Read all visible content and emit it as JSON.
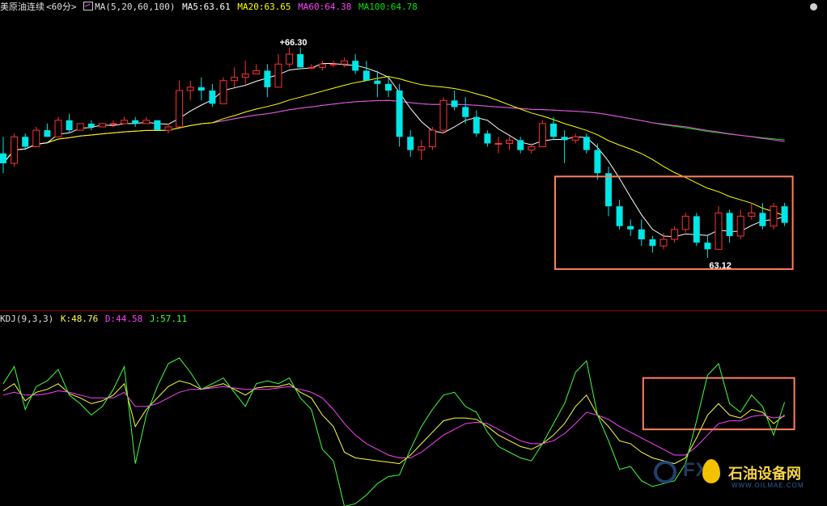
{
  "header": {
    "symbol": "美原油连续",
    "period": "<60分>",
    "ma_params": "MA(5,20,60,100)",
    "ma5": "MA5:63.61",
    "ma20": "MA20:63.65",
    "ma60": "MA60:64.38",
    "ma100": "MA100:64.78"
  },
  "kdj_header": {
    "params": "KDJ(9,3,3)",
    "k": "K:48.76",
    "d": "D:44.58",
    "j": "J:57.11"
  },
  "colors": {
    "up": "#ff3232",
    "down": "#00e5e5",
    "ma5": "#ffffff",
    "ma20": "#ffff00",
    "ma60": "#ff40ff",
    "ma100": "#00e600",
    "k": "#ffff40",
    "d": "#ff40ff",
    "j": "#40ff40",
    "highlight_box": "#ff8060"
  },
  "chart_data": [
    {
      "type": "candlestick",
      "ylim": [
        62.35,
        66.75
      ],
      "max_label": "66.30",
      "min_label": "63.12",
      "candles": [
        [
          64.7,
          64.95,
          64.4,
          64.55
        ],
        [
          64.55,
          65.0,
          64.5,
          64.95
        ],
        [
          64.95,
          65.0,
          64.75,
          64.8
        ],
        [
          64.8,
          65.1,
          64.8,
          65.05
        ],
        [
          65.05,
          65.15,
          64.95,
          64.95
        ],
        [
          64.95,
          65.25,
          64.95,
          65.2
        ],
        [
          65.2,
          65.3,
          65.0,
          65.05
        ],
        [
          65.05,
          65.15,
          65.05,
          65.15
        ],
        [
          65.15,
          65.2,
          65.05,
          65.1
        ],
        [
          65.1,
          65.15,
          65.1,
          65.15
        ],
        [
          65.15,
          65.2,
          65.1,
          65.15
        ],
        [
          65.15,
          65.25,
          65.15,
          65.2
        ],
        [
          65.2,
          65.25,
          65.1,
          65.15
        ],
        [
          65.15,
          65.25,
          65.15,
          65.2
        ],
        [
          65.2,
          65.2,
          65.05,
          65.05
        ],
        [
          65.05,
          65.15,
          65.0,
          65.1
        ],
        [
          65.1,
          65.8,
          65.1,
          65.65
        ],
        [
          65.65,
          65.8,
          65.5,
          65.7
        ],
        [
          65.7,
          65.85,
          65.5,
          65.65
        ],
        [
          65.65,
          65.75,
          65.4,
          65.45
        ],
        [
          65.45,
          65.85,
          65.45,
          65.8
        ],
        [
          65.8,
          66.0,
          65.7,
          65.85
        ],
        [
          65.85,
          66.1,
          65.75,
          65.9
        ],
        [
          65.9,
          66.05,
          65.9,
          65.95
        ],
        [
          65.95,
          66.05,
          65.55,
          65.7
        ],
        [
          65.7,
          66.2,
          65.7,
          66.05
        ],
        [
          66.05,
          66.3,
          66.0,
          66.2
        ],
        [
          66.2,
          66.3,
          66.0,
          66.0
        ],
        [
          66.0,
          66.05,
          66.0,
          66.0
        ],
        [
          66.0,
          66.1,
          65.95,
          66.05
        ],
        [
          66.05,
          66.1,
          66.0,
          66.05
        ],
        [
          66.05,
          66.15,
          66.0,
          66.1
        ],
        [
          66.1,
          66.2,
          65.9,
          65.95
        ],
        [
          65.95,
          66.1,
          65.8,
          65.8
        ],
        [
          65.8,
          65.95,
          65.55,
          65.75
        ],
        [
          65.75,
          65.85,
          65.55,
          65.65
        ],
        [
          65.65,
          65.75,
          64.8,
          64.95
        ],
        [
          64.95,
          65.05,
          64.65,
          64.75
        ],
        [
          64.75,
          64.9,
          64.6,
          64.8
        ],
        [
          64.8,
          65.1,
          64.75,
          65.05
        ],
        [
          65.05,
          65.55,
          65.0,
          65.5
        ],
        [
          65.5,
          65.65,
          65.35,
          65.4
        ],
        [
          65.4,
          65.55,
          65.15,
          65.25
        ],
        [
          65.25,
          65.35,
          64.95,
          65.0
        ],
        [
          65.0,
          65.05,
          64.8,
          64.85
        ],
        [
          64.85,
          64.95,
          64.7,
          64.85
        ],
        [
          64.85,
          64.95,
          64.75,
          64.9
        ],
        [
          64.9,
          64.95,
          64.7,
          64.75
        ],
        [
          64.75,
          64.85,
          64.7,
          64.8
        ],
        [
          64.8,
          65.2,
          64.8,
          65.15
        ],
        [
          65.15,
          65.25,
          64.9,
          64.95
        ],
        [
          64.95,
          65.05,
          64.55,
          64.9
        ],
        [
          64.9,
          65.0,
          64.85,
          64.95
        ],
        [
          64.95,
          65.0,
          64.7,
          64.75
        ],
        [
          64.75,
          64.85,
          64.3,
          64.4
        ],
        [
          64.4,
          64.5,
          63.75,
          63.9
        ],
        [
          63.9,
          64.0,
          63.55,
          63.6
        ],
        [
          63.6,
          63.7,
          63.45,
          63.55
        ],
        [
          63.55,
          63.7,
          63.3,
          63.4
        ],
        [
          63.4,
          63.45,
          63.2,
          63.3
        ],
        [
          63.3,
          63.5,
          63.25,
          63.4
        ],
        [
          63.4,
          63.6,
          63.35,
          63.55
        ],
        [
          63.55,
          63.8,
          63.5,
          63.75
        ],
        [
          63.75,
          63.8,
          63.3,
          63.35
        ],
        [
          63.35,
          63.45,
          63.12,
          63.25
        ],
        [
          63.25,
          63.9,
          63.25,
          63.8
        ],
        [
          63.8,
          63.85,
          63.35,
          63.45
        ],
        [
          63.45,
          63.85,
          63.4,
          63.75
        ],
        [
          63.75,
          63.95,
          63.7,
          63.8
        ],
        [
          63.8,
          63.95,
          63.55,
          63.6
        ],
        [
          63.6,
          63.95,
          63.55,
          63.9
        ],
        [
          63.9,
          63.95,
          63.6,
          63.65
        ]
      ]
    },
    {
      "type": "line",
      "indicator": "KDJ",
      "ylim": [
        -10,
        110
      ],
      "series": [
        {
          "name": "K",
          "values": [
            65,
            70,
            58,
            64,
            66,
            70,
            63,
            60,
            56,
            58,
            62,
            70,
            40,
            52,
            60,
            68,
            72,
            70,
            66,
            68,
            70,
            66,
            62,
            67,
            68,
            68,
            70,
            64,
            60,
            48,
            40,
            22,
            18,
            17,
            16,
            15,
            14,
            20,
            28,
            36,
            44,
            46,
            46,
            45,
            40,
            34,
            30,
            26,
            24,
            28,
            34,
            42,
            54,
            62,
            48,
            40,
            30,
            28,
            22,
            18,
            16,
            14,
            18,
            32,
            48,
            56,
            48,
            46,
            52,
            50,
            42,
            48
          ]
        },
        {
          "name": "D",
          "values": [
            62,
            64,
            62,
            62,
            63,
            65,
            64,
            62,
            60,
            60,
            60,
            64,
            54,
            54,
            56,
            60,
            64,
            66,
            66,
            67,
            68,
            67,
            66,
            66,
            66,
            67,
            68,
            66,
            64,
            60,
            52,
            42,
            34,
            28,
            24,
            20,
            18,
            18,
            22,
            28,
            34,
            38,
            42,
            43,
            42,
            38,
            34,
            30,
            28,
            28,
            30,
            35,
            42,
            50,
            48,
            45,
            40,
            36,
            32,
            28,
            24,
            20,
            20,
            26,
            34,
            42,
            44,
            44,
            47,
            48,
            46,
            47
          ]
        },
        {
          "name": "J",
          "values": [
            70,
            82,
            52,
            68,
            72,
            80,
            62,
            56,
            48,
            54,
            66,
            82,
            14,
            48,
            68,
            84,
            88,
            78,
            66,
            70,
            74,
            64,
            54,
            70,
            72,
            70,
            74,
            60,
            52,
            24,
            16,
            -16,
            -14,
            -8,
            0,
            5,
            6,
            24,
            40,
            52,
            62,
            64,
            54,
            50,
            36,
            26,
            22,
            18,
            16,
            28,
            42,
            56,
            78,
            86,
            48,
            30,
            10,
            12,
            2,
            -2,
            0,
            2,
            14,
            44,
            76,
            84,
            56,
            50,
            62,
            54,
            34,
            57
          ]
        }
      ]
    }
  ]
}
